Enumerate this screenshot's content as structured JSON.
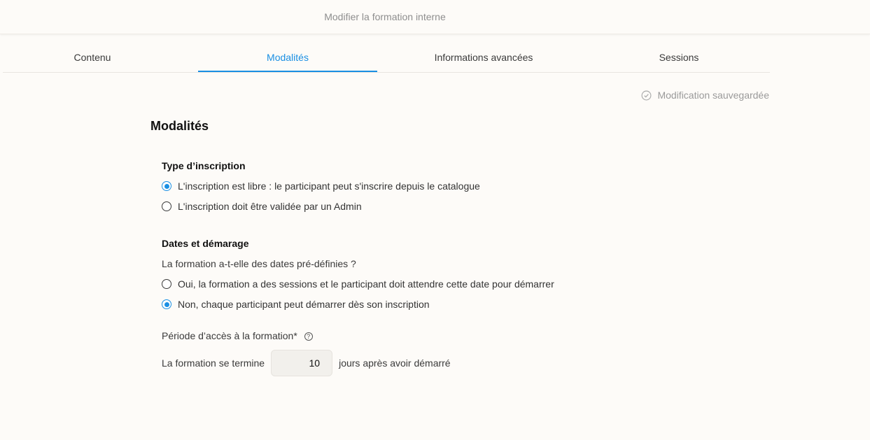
{
  "header": {
    "title": "Modifier la formation interne"
  },
  "tabs": [
    {
      "label": "Contenu",
      "active": false
    },
    {
      "label": "Modalités",
      "active": true
    },
    {
      "label": "Informations avancées",
      "active": false
    },
    {
      "label": "Sessions",
      "active": false
    }
  ],
  "status": {
    "saved_text": "Modification sauvegardée"
  },
  "section": {
    "title": "Modalités"
  },
  "inscription": {
    "title": "Type d’inscription",
    "options": [
      {
        "label": "L'inscription est libre : le participant peut s'inscrire depuis le catalogue",
        "checked": true
      },
      {
        "label": "L'inscription doit être validée par un Admin",
        "checked": false
      }
    ]
  },
  "dates": {
    "title": "Dates et démarage",
    "question": "La formation a-t-elle des dates pré-définies ?",
    "options": [
      {
        "label": "Oui, la formation a des sessions et le participant doit attendre cette date pour démarrer",
        "checked": false
      },
      {
        "label": "Non, chaque participant peut démarrer dès son inscription",
        "checked": true
      }
    ]
  },
  "access": {
    "label": "Période d’accès à la formation*",
    "help_icon": "?",
    "prefix": "La formation se termine",
    "days_value": "10",
    "suffix": "jours après avoir démarré"
  },
  "colors": {
    "accent": "#1a8fe3",
    "background": "#fdfbf8"
  }
}
